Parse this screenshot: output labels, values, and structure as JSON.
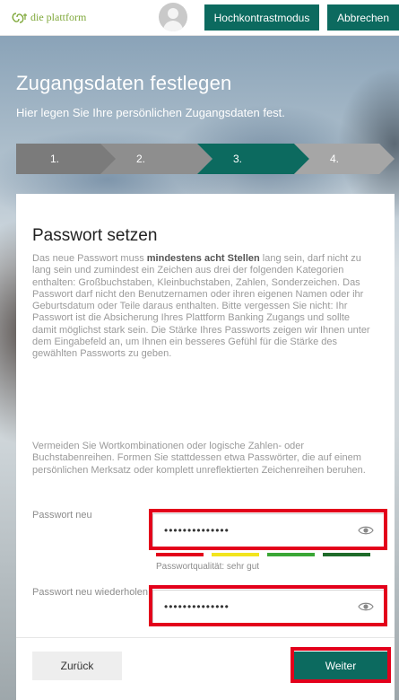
{
  "header": {
    "logo_text": "die plattform",
    "contrast_label": "Hochkontrastmodus",
    "cancel_label": "Abbrechen"
  },
  "page": {
    "title": "Zugangsdaten festlegen",
    "subtitle": "Hier legen Sie Ihre persönlichen Zugangsdaten fest."
  },
  "stepper": {
    "steps": [
      "1.",
      "2.",
      "3.",
      "4."
    ],
    "active_index": 3
  },
  "form": {
    "heading": "Passwort setzen",
    "para1_before": "Das neue Passwort muss ",
    "para1_bold": "mindestens acht Stellen",
    "para1_after": " lang sein, darf nicht zu lang sein und zumindest ein Zeichen aus drei der folgenden Kategorien enthalten: Großbuchstaben, Kleinbuchstaben, Zahlen, Sonderzeichen. Das Passwort darf nicht den Benutzernamen oder ihren eigenen Namen oder ihr Geburtsdatum oder Teile daraus enthalten. Bitte vergessen Sie nicht: Ihr Passwort ist die Absicherung Ihres Plattform Banking Zugangs und sollte damit möglichst stark sein. Die Stärke Ihres Passworts zeigen wir Ihnen unter dem Eingabefeld an, um Ihnen ein besseres Gefühl für die Stärke des gewählten Passworts zu geben.",
    "para2": "Vermeiden Sie Wortkombinationen oder logische Zahlen- oder Buchstabenreihen. Formen Sie stattdessen etwa Passwörter, die auf einem persönlichen Merksatz oder komplett unreflektierten Zeichenreihen beruhen.",
    "new_password_label": "Passwort neu",
    "new_password_value": "••••••••••••••",
    "repeat_password_label": "Passwort neu wiederholen",
    "repeat_password_value": "••••••••••••••",
    "quality_text": "Passwortqualität: sehr gut",
    "strength_level": 4,
    "strength_colors": [
      "#e3001b",
      "#f2e51e",
      "#3aa635",
      "#1f6b2a"
    ],
    "back_label": "Zurück",
    "next_label": "Weiter"
  },
  "colors": {
    "accent": "#0c6a5f",
    "highlight": "#e3001b"
  }
}
